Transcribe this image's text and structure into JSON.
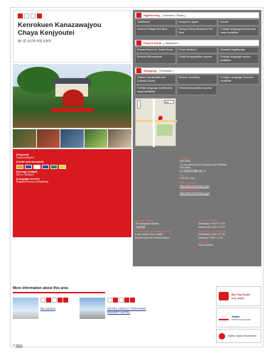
{
  "spot": {
    "title_line1": "Kenrokuen Kanazawajyou",
    "title_line2": "Chaya Kenjyoutei",
    "subtitle_jp": "兼六園 金沢城 茶屋 見城亭"
  },
  "colors": {
    "accent": "#d71920",
    "panel": "#777777",
    "cell": "#5e5e5e"
  },
  "info": {
    "payment_label": "[Payment]",
    "payment_value": "Card/Cashpoint",
    "credit_label": "[Credit card accepted]",
    "budget_label": "[Average budget]",
    "budget_value": "500 to 3000yen",
    "language_label": "[Language service]",
    "language_value": "English/Chinese (Simplified)"
  },
  "sections": {
    "sightseeing": {
      "name": "Sightseeing",
      "sub": "[ Gardens / Parks ]",
      "cells": [
        "Traditional",
        "Unique to Japan",
        "Events",
        "Autumn Foliage Hot Spot",
        "Spring Cherry Blossoms Hot Spot",
        "Foreign language tourist area maps available"
      ]
    },
    "food": {
      "name": "Food & Drink",
      "sub": "[ Japanese ]",
      "cells": [
        "Private Room for Small Group",
        "Fresh Seafood",
        "Beautiful Nightscape",
        "Relaxed Atmosphere",
        "Great transportation access",
        "Foreign language menus available"
      ]
    },
    "shopping": {
      "name": "Shopping",
      "sub": "[ Souvenir ]",
      "cells": [
        "Carries Handicrafts and Cultural Goods",
        "Diverse Inventory",
        "Foreign Language Services Available",
        "Foreign language tourist area maps available",
        "Great transportation access",
        ""
      ]
    }
  },
  "map": {
    "select": "Map"
  },
  "address": {
    "addr_label": "[Address]",
    "addr_value": "920-0936",
    "addr_detail": "1-5 Kenrokumachi Kanazawa-shi Ishikawa",
    "addr_jp_code": "920-0936",
    "addr_jp": "石川県金沢市兼六町1-5",
    "tel_label": "[Tel]",
    "tel_value": "076-221-1xxx",
    "url_en_label": "[URL(English)]",
    "url_en_value": "http://www.kenrokuen.or.jp/",
    "url_jp_label": "[URL(Japanese)]",
    "url_jp_value": "http://www.kenrokuen.or.jp/"
  },
  "access": {
    "station_label": "[Nearest Station]",
    "station_value": "JR Kanazawa Station",
    "station_jp": "JR金沢駅",
    "access_label": "[Access from the nearest station]",
    "access_value": "5 min. (bus) 5 min. (walk)",
    "access_value2": "Access from the nearest station",
    "hours_label": "[Business Hours]",
    "hours_value": "Weekdays: 9:00～17:00",
    "hours_value2": "Weekends: 9:00～17:00",
    "hours_foreign_label": "[Business hours (foreign)]",
    "hours_foreign_value": "Weekdays: 9:00～17:00",
    "hours_foreign_value2": "Holidays: 9:00～17:00",
    "closed_label": "[Closed]",
    "closed_value": "Never closed"
  },
  "more": {
    "heading": "More information about this area",
    "items": [
      {
        "label": "Bic camera"
      },
      {
        "label": "HOTEL KISOCIA TAKAYAMA RESORT HOTEL"
      }
    ]
  },
  "back_label": "Back",
  "side": {
    "trip_line1": "My Trip Guide",
    "trip_line2": "(my page)",
    "jnto_line1": "Japan",
    "jnto_line2": "Official Travel Guide",
    "safety": "Safety Japan Information"
  }
}
